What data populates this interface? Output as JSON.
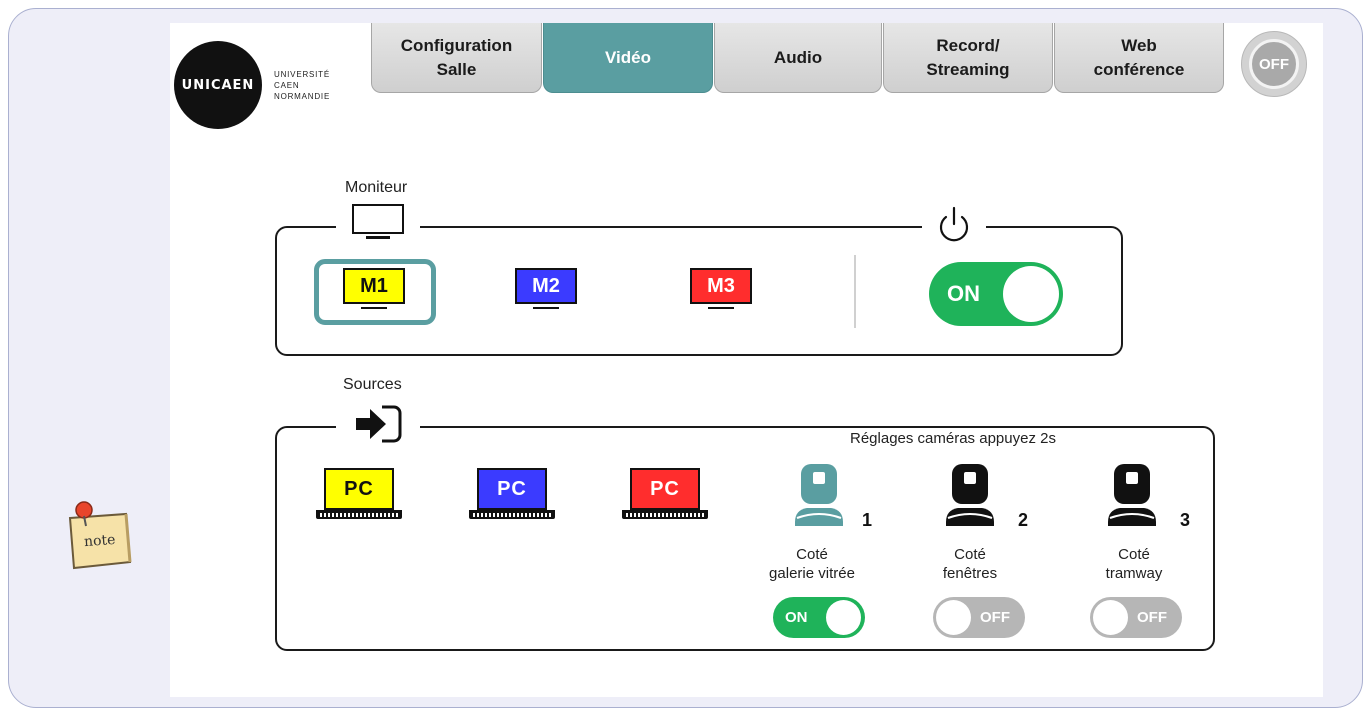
{
  "header": {
    "logo_mark": "UNICAEN",
    "logo_lines": [
      "UNIVERSITÉ",
      "CAEN",
      "NORMANDIE"
    ],
    "tabs": [
      {
        "label": "Configuration\nSalle",
        "active": false
      },
      {
        "label": "Vidéo",
        "active": true
      },
      {
        "label": "Audio",
        "active": false
      },
      {
        "label": "Record/\nStreaming",
        "active": false
      },
      {
        "label": "Web\nconférence",
        "active": false
      }
    ],
    "off_label": "OFF"
  },
  "monitor": {
    "title": "Moniteur",
    "monitors": [
      {
        "label": "M1",
        "color": "#ffff00",
        "text_color": "#111111",
        "selected": true
      },
      {
        "label": "M2",
        "color": "#3b3bff",
        "text_color": "#ffffff",
        "selected": false
      },
      {
        "label": "M3",
        "color": "#ff2d2d",
        "text_color": "#ffffff",
        "selected": false
      }
    ],
    "power_toggle": {
      "label": "ON",
      "state": "on"
    }
  },
  "sources": {
    "title": "Sources",
    "camera_hint": "Réglages caméras appuyez 2s",
    "pcs": [
      {
        "label": "PC",
        "color": "#ffff00",
        "text_color": "#111111"
      },
      {
        "label": "PC",
        "color": "#3b3bff",
        "text_color": "#ffffff"
      },
      {
        "label": "PC",
        "color": "#ff2d2d",
        "text_color": "#ffffff"
      }
    ],
    "cameras": [
      {
        "number": "1",
        "caption_line1": "Coté",
        "caption_line2": "galerie vitrée",
        "toggle_label": "ON",
        "state": "on",
        "color": "#5a9ea1"
      },
      {
        "number": "2",
        "caption_line1": "Coté",
        "caption_line2": "fenêtres",
        "toggle_label": "OFF",
        "state": "off",
        "color": "#111111"
      },
      {
        "number": "3",
        "caption_line1": "Coté",
        "caption_line2": "tramway",
        "toggle_label": "OFF",
        "state": "off",
        "color": "#111111"
      }
    ]
  },
  "side_note": {
    "label": "note"
  }
}
